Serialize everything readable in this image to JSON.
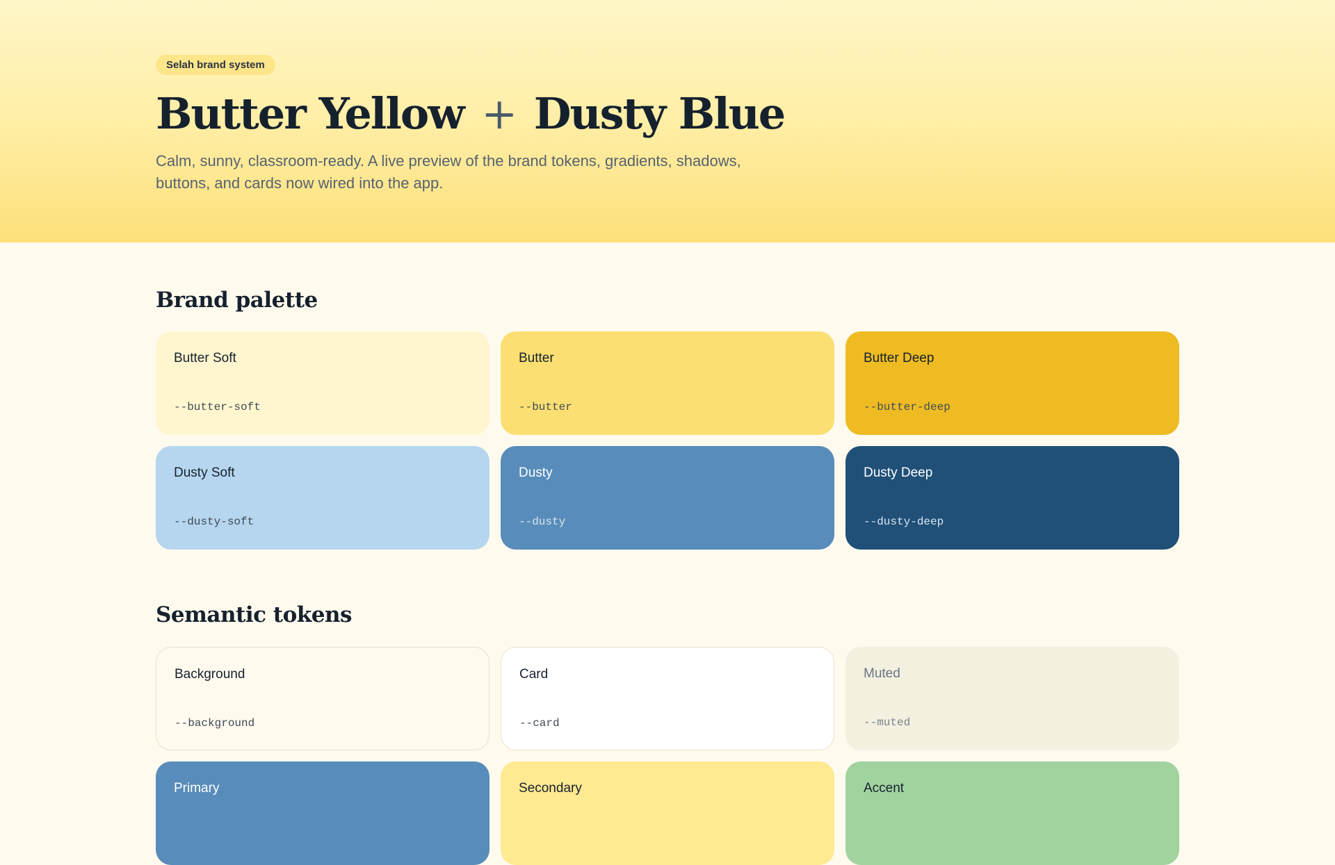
{
  "hero": {
    "badge": "Selah brand system",
    "title_part1": "Butter Yellow",
    "title_plus": "+",
    "title_part2": "Dusty Blue",
    "subtitle": "Calm, sunny, classroom-ready. A live preview of the brand tokens, gradients, shadows, buttons, and cards now wired into the app."
  },
  "palette": {
    "title": "Brand palette",
    "swatches": [
      {
        "name": "Butter Soft",
        "token": "--butter-soft",
        "color": "#fff6cf"
      },
      {
        "name": "Butter",
        "token": "--butter",
        "color": "#fbdf72"
      },
      {
        "name": "Butter Deep",
        "token": "--butter-deep",
        "color": "#eebb23"
      },
      {
        "name": "Dusty Soft",
        "token": "--dusty-soft",
        "color": "#b6d6ef"
      },
      {
        "name": "Dusty",
        "token": "--dusty",
        "color": "#588cba"
      },
      {
        "name": "Dusty Deep",
        "token": "--dusty-deep",
        "color": "#205078"
      }
    ]
  },
  "semantic": {
    "title": "Semantic tokens",
    "swatches": [
      {
        "name": "Background",
        "token": "--background",
        "color": "#fffaee"
      },
      {
        "name": "Card",
        "token": "--card",
        "color": "#ffffff"
      },
      {
        "name": "Muted",
        "token": "--muted",
        "color": "#f3f0e0"
      },
      {
        "name": "Primary",
        "token": "",
        "color": "#588cba"
      },
      {
        "name": "Secondary",
        "token": "",
        "color": "#ffe991"
      },
      {
        "name": "Accent",
        "token": "",
        "color": "#a1d39f"
      }
    ]
  }
}
